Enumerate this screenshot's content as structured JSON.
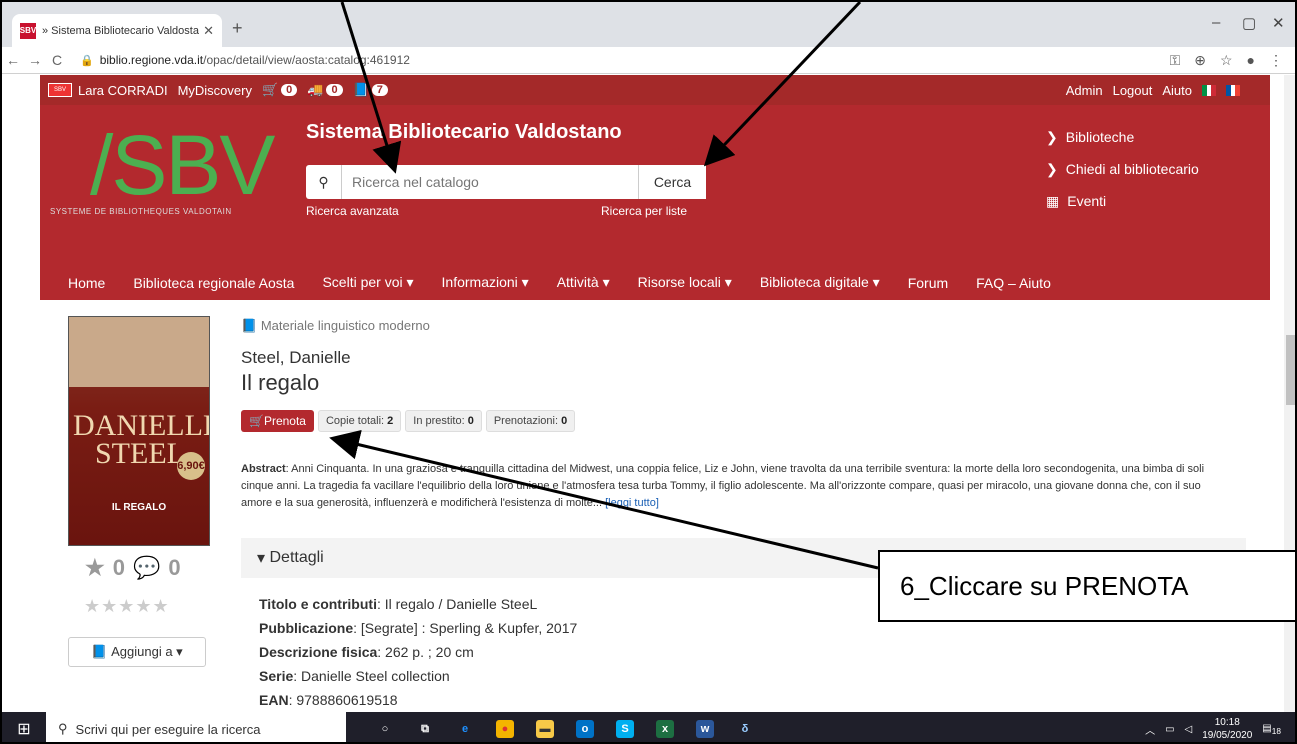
{
  "browser": {
    "tab_title": "» Sistema Bibliotecario Valdostan",
    "favicon": "SBV",
    "url_host": "biblio.regione.vda.it",
    "url_path": "/opac/detail/view/aosta:catalog:461912"
  },
  "topbar": {
    "user": "Lara CORRADI",
    "mydiscovery": "MyDiscovery",
    "cart_count": "0",
    "truck_count": "0",
    "book_count": "7",
    "admin": "Admin",
    "logout": "Logout",
    "help": "Aiuto"
  },
  "header": {
    "logo": "/SBV",
    "logo_sub": "SYSTEME DE BIBLIOTHEQUES VALDOTAIN",
    "title": "Sistema Bibliotecario Valdostano",
    "search_placeholder": "Ricerca nel catalogo",
    "search_button": "Cerca",
    "advanced": "Ricerca avanzata",
    "lists": "Ricerca per liste",
    "side_links": [
      "Biblioteche",
      "Chiedi al bibliotecario",
      "Eventi"
    ]
  },
  "nav": [
    "Home",
    "Biblioteca regionale Aosta",
    "Scelti per voi ▾",
    "Informazioni ▾",
    "Attività ▾",
    "Risorse locali ▾",
    "Biblioteca digitale ▾",
    "Forum",
    "FAQ – Aiuto"
  ],
  "record": {
    "material": "Materiale linguistico moderno",
    "author": "Steel, Danielle",
    "title": "Il regalo",
    "prenota": "Prenota",
    "copies_label": "Copie totali:",
    "copies": "2",
    "loan_label": "In prestito:",
    "loan": "0",
    "holds_label": "Prenotazioni:",
    "holds": "0",
    "abstract_label": "Abstract",
    "abstract": ": Anni Cinquanta. In una graziosa e tranquilla cittadina del Midwest, una coppia felice, Liz e John, viene travolta da una terribile sventura: la morte della loro secondogenita, una bimba di soli cinque anni. La tragedia fa vacillare l'equilibrio della loro unione e l'atmosfera tesa turba Tommy, il figlio adolescente. Ma all'orizzonte compare, quasi per miracolo, una giovane donna che, con il suo amore e la sua generosità, influenzerà e modificherà l'esistenza di molte... ",
    "read_more": "[leggi tutto]",
    "rating": "0",
    "comments": "0",
    "add_to": "Aggiungi a ▾",
    "cover_author": "DANIELLE STEEL",
    "cover_title": "IL REGALO",
    "cover_price": "6,90€"
  },
  "details": {
    "heading": "Dettagli",
    "rows": [
      {
        "label": "Titolo e contributi",
        "value": ": Il regalo / Danielle SteeL"
      },
      {
        "label": "Pubblicazione",
        "value": ": [Segrate] : Sperling & Kupfer, 2017"
      },
      {
        "label": "Descrizione fisica",
        "value": ": 262 p. ; 20 cm"
      },
      {
        "label": "Serie",
        "value": ": Danielle Steel collection"
      },
      {
        "label": "EAN",
        "value": ": 9788860619518"
      }
    ]
  },
  "taskbar": {
    "search": "Scrivi qui per eseguire la ricerca",
    "time": "10:18",
    "date": "19/05/2020",
    "notif": "18"
  },
  "annotation": {
    "callout": "6_Cliccare su PRENOTA"
  }
}
